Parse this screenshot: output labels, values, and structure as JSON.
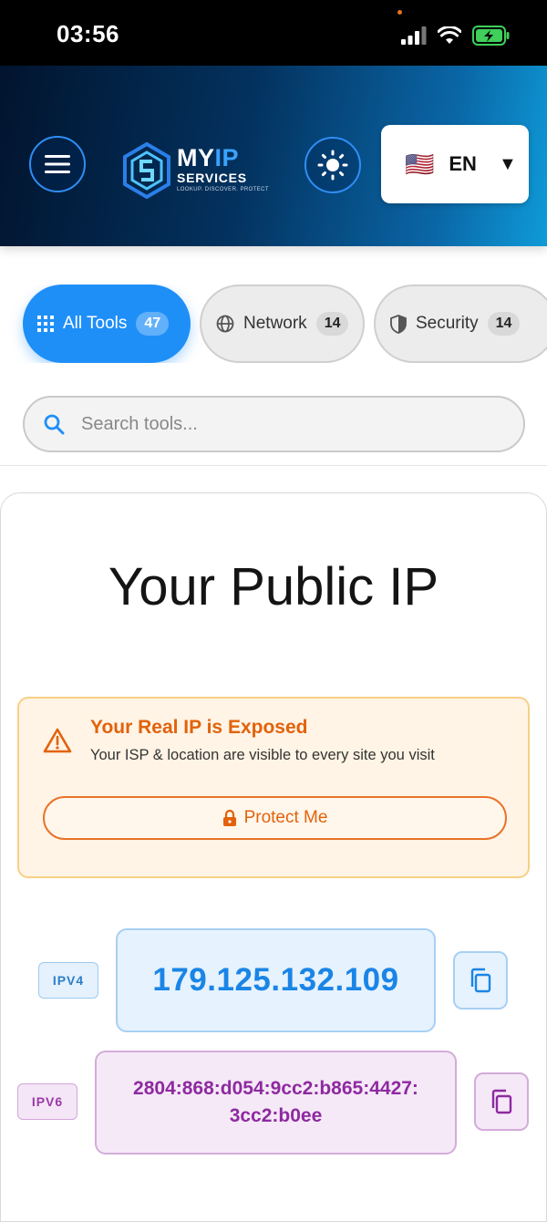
{
  "status_bar": {
    "time": "03:56"
  },
  "header": {
    "logo": {
      "title_prefix": "MY",
      "title_highlight": "IP",
      "subtitle": "SERVICES",
      "tagline": "LOOKUP. DISCOVER. PROTECT"
    },
    "language": {
      "flag": "🇺🇸",
      "code": "EN",
      "caret": "▼"
    }
  },
  "categories": [
    {
      "label": "All Tools",
      "count": "47",
      "icon": "grid-icon",
      "active": true
    },
    {
      "label": "Network",
      "count": "14",
      "icon": "globe-icon",
      "active": false
    },
    {
      "label": "Security",
      "count": "14",
      "icon": "shield-icon",
      "active": false
    }
  ],
  "search": {
    "placeholder": "Search tools...",
    "value": ""
  },
  "main": {
    "title": "Your Public IP",
    "alert": {
      "title": "Your Real IP is Exposed",
      "text": "Your ISP & location are visible to every site you visit",
      "button_label": "Protect Me"
    },
    "ipv4": {
      "tag": "IPV4",
      "address": "179.125.132.109"
    },
    "ipv6": {
      "tag": "IPV6",
      "address": "2804:868:d054:9cc2:b865:4427:3cc2:b0ee"
    }
  },
  "colors": {
    "accent": "#1f8ff8",
    "warning": "#e2620c",
    "ipv4": "#1a85e6",
    "ipv6": "#8e2aa0"
  }
}
